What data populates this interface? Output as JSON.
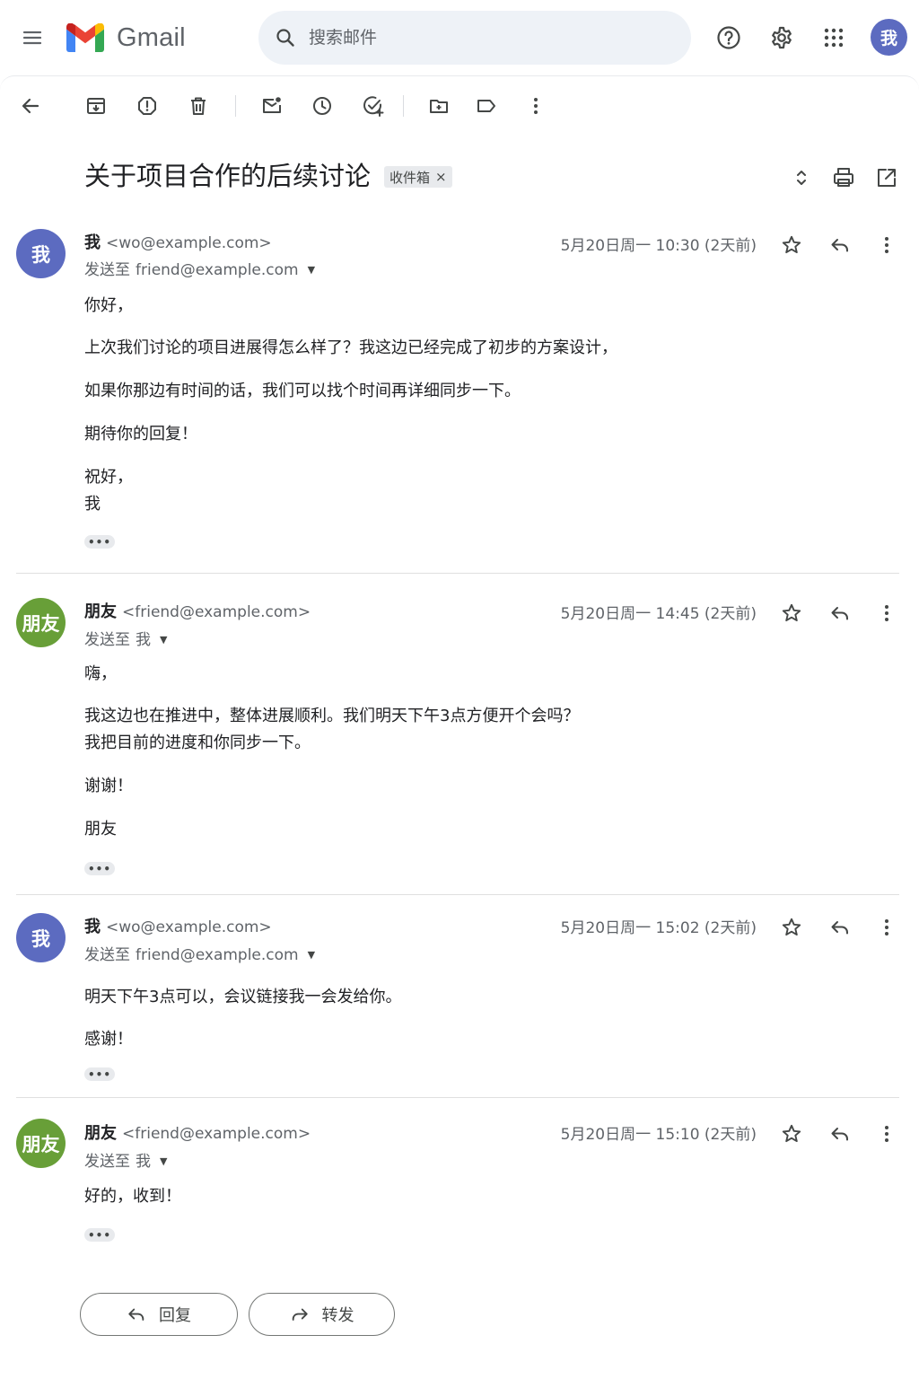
{
  "app": {
    "name": "Gmail"
  },
  "search": {
    "placeholder": "搜索邮件"
  },
  "user": {
    "initial": "我",
    "color": "#5c6bc0"
  },
  "thread": {
    "subject": "关于项目合作的后续讨论",
    "label": "收件箱"
  },
  "messages": [
    {
      "name": "我",
      "email": "<wo@example.com>",
      "to_prefix": "发送至",
      "to": "friend@example.com",
      "time": "5月20日周一 10:30 (2天前)",
      "avatar": "我",
      "avatar_color": "#5c6bc0",
      "lines": [
        "你好，",
        "上次我们讨论的项目进展得怎么样了？我这边已经完成了初步的方案设计，",
        "如果你那边有时间的话，我们可以找个时间再详细同步一下。",
        "期待你的回复！",
        "祝好，",
        "我"
      ]
    },
    {
      "name": "朋友",
      "email": "<friend@example.com>",
      "to_prefix": "发送至",
      "to": "我",
      "time": "5月20日周一 14:45 (2天前)",
      "avatar": "朋友",
      "avatar_color": "#689f38",
      "lines": [
        "嗨，",
        "我这边也在推进中，整体进展顺利。我们明天下午3点方便开个会吗？",
        "我把目前的进度和你同步一下。",
        "谢谢！",
        "朋友"
      ]
    },
    {
      "name": "我",
      "email": "<wo@example.com>",
      "to_prefix": "发送至",
      "to": "friend@example.com",
      "time": "5月20日周一 15:02 (2天前)",
      "avatar": "我",
      "avatar_color": "#5c6bc0",
      "lines": [
        "明天下午3点可以，会议链接我一会发给你。",
        "感谢！"
      ]
    },
    {
      "name": "朋友",
      "email": "<friend@example.com>",
      "to_prefix": "发送至",
      "to": "我",
      "time": "5月20日周一 15:10 (2天前)",
      "avatar": "朋友",
      "avatar_color": "#689f38",
      "lines": [
        "好的，收到！"
      ]
    }
  ],
  "actions": {
    "reply": "回复",
    "forward": "转发"
  },
  "icons": {
    "toolbar": [
      "back-arrow-icon",
      "archive-icon",
      "report-spam-icon",
      "delete-icon",
      "mark-unread-icon",
      "snooze-icon",
      "add-task-icon",
      "move-to-icon",
      "label-icon",
      "more-vert-icon"
    ],
    "message": [
      "star-icon",
      "reply-icon",
      "more-vert-icon"
    ]
  },
  "colors": {
    "accent": "#5c6bc0",
    "friend": "#689f38",
    "search_bg": "#eef2f7"
  }
}
